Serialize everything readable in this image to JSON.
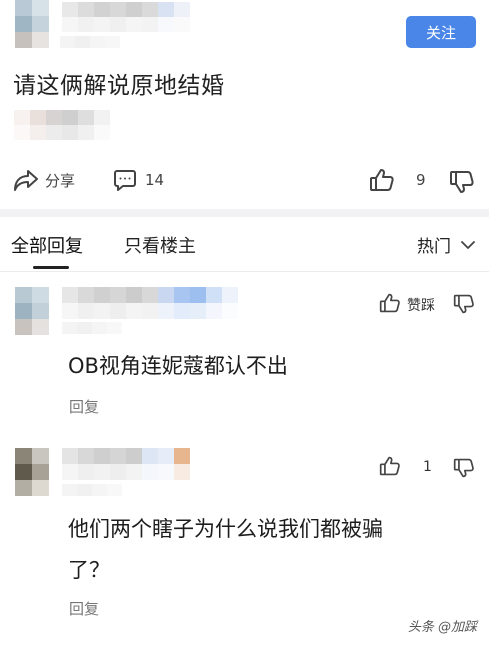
{
  "post": {
    "follow_label": "关注",
    "text": "请这俩解说原地结婚",
    "share_label": "分享",
    "comment_count": "14",
    "like_count": "9"
  },
  "tabs": {
    "all_replies": "全部回复",
    "author_only": "只看楼主",
    "sort_label": "热门"
  },
  "comments": [
    {
      "text": "OB视角连妮蔻都认不出",
      "like_label": "赞踩",
      "reply_label": "回复"
    },
    {
      "text_line1": "他们两个瞎子为什么说我们都被骗",
      "text_line2": "了？",
      "like_count": "1",
      "reply_label": "回复"
    }
  ],
  "watermark": "头条 @加踩",
  "icons": {
    "share": "share-arrow-icon",
    "comment": "comment-bubble-icon",
    "like": "thumbs-up-icon",
    "dislike": "thumbs-down-icon",
    "sort": "chevron-down-icon"
  },
  "colors": {
    "accent": "#4a86e8",
    "text": "#222222",
    "muted": "#777777"
  }
}
